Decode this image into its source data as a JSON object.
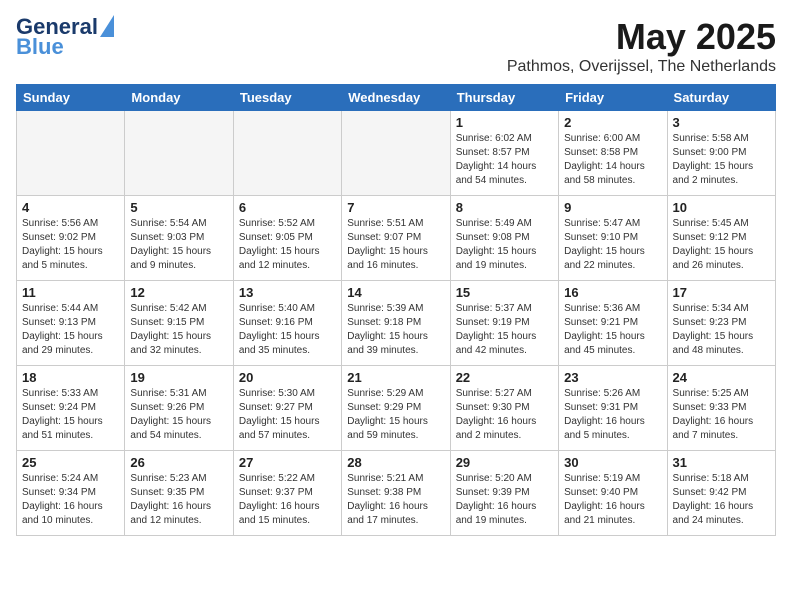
{
  "header": {
    "logo_line1": "General",
    "logo_line2": "Blue",
    "month_title": "May 2025",
    "location": "Pathmos, Overijssel, The Netherlands"
  },
  "days_of_week": [
    "Sunday",
    "Monday",
    "Tuesday",
    "Wednesday",
    "Thursday",
    "Friday",
    "Saturday"
  ],
  "weeks": [
    [
      {
        "day": "",
        "info": ""
      },
      {
        "day": "",
        "info": ""
      },
      {
        "day": "",
        "info": ""
      },
      {
        "day": "",
        "info": ""
      },
      {
        "day": "1",
        "info": "Sunrise: 6:02 AM\nSunset: 8:57 PM\nDaylight: 14 hours\nand 54 minutes."
      },
      {
        "day": "2",
        "info": "Sunrise: 6:00 AM\nSunset: 8:58 PM\nDaylight: 14 hours\nand 58 minutes."
      },
      {
        "day": "3",
        "info": "Sunrise: 5:58 AM\nSunset: 9:00 PM\nDaylight: 15 hours\nand 2 minutes."
      }
    ],
    [
      {
        "day": "4",
        "info": "Sunrise: 5:56 AM\nSunset: 9:02 PM\nDaylight: 15 hours\nand 5 minutes."
      },
      {
        "day": "5",
        "info": "Sunrise: 5:54 AM\nSunset: 9:03 PM\nDaylight: 15 hours\nand 9 minutes."
      },
      {
        "day": "6",
        "info": "Sunrise: 5:52 AM\nSunset: 9:05 PM\nDaylight: 15 hours\nand 12 minutes."
      },
      {
        "day": "7",
        "info": "Sunrise: 5:51 AM\nSunset: 9:07 PM\nDaylight: 15 hours\nand 16 minutes."
      },
      {
        "day": "8",
        "info": "Sunrise: 5:49 AM\nSunset: 9:08 PM\nDaylight: 15 hours\nand 19 minutes."
      },
      {
        "day": "9",
        "info": "Sunrise: 5:47 AM\nSunset: 9:10 PM\nDaylight: 15 hours\nand 22 minutes."
      },
      {
        "day": "10",
        "info": "Sunrise: 5:45 AM\nSunset: 9:12 PM\nDaylight: 15 hours\nand 26 minutes."
      }
    ],
    [
      {
        "day": "11",
        "info": "Sunrise: 5:44 AM\nSunset: 9:13 PM\nDaylight: 15 hours\nand 29 minutes."
      },
      {
        "day": "12",
        "info": "Sunrise: 5:42 AM\nSunset: 9:15 PM\nDaylight: 15 hours\nand 32 minutes."
      },
      {
        "day": "13",
        "info": "Sunrise: 5:40 AM\nSunset: 9:16 PM\nDaylight: 15 hours\nand 35 minutes."
      },
      {
        "day": "14",
        "info": "Sunrise: 5:39 AM\nSunset: 9:18 PM\nDaylight: 15 hours\nand 39 minutes."
      },
      {
        "day": "15",
        "info": "Sunrise: 5:37 AM\nSunset: 9:19 PM\nDaylight: 15 hours\nand 42 minutes."
      },
      {
        "day": "16",
        "info": "Sunrise: 5:36 AM\nSunset: 9:21 PM\nDaylight: 15 hours\nand 45 minutes."
      },
      {
        "day": "17",
        "info": "Sunrise: 5:34 AM\nSunset: 9:23 PM\nDaylight: 15 hours\nand 48 minutes."
      }
    ],
    [
      {
        "day": "18",
        "info": "Sunrise: 5:33 AM\nSunset: 9:24 PM\nDaylight: 15 hours\nand 51 minutes."
      },
      {
        "day": "19",
        "info": "Sunrise: 5:31 AM\nSunset: 9:26 PM\nDaylight: 15 hours\nand 54 minutes."
      },
      {
        "day": "20",
        "info": "Sunrise: 5:30 AM\nSunset: 9:27 PM\nDaylight: 15 hours\nand 57 minutes."
      },
      {
        "day": "21",
        "info": "Sunrise: 5:29 AM\nSunset: 9:29 PM\nDaylight: 15 hours\nand 59 minutes."
      },
      {
        "day": "22",
        "info": "Sunrise: 5:27 AM\nSunset: 9:30 PM\nDaylight: 16 hours\nand 2 minutes."
      },
      {
        "day": "23",
        "info": "Sunrise: 5:26 AM\nSunset: 9:31 PM\nDaylight: 16 hours\nand 5 minutes."
      },
      {
        "day": "24",
        "info": "Sunrise: 5:25 AM\nSunset: 9:33 PM\nDaylight: 16 hours\nand 7 minutes."
      }
    ],
    [
      {
        "day": "25",
        "info": "Sunrise: 5:24 AM\nSunset: 9:34 PM\nDaylight: 16 hours\nand 10 minutes."
      },
      {
        "day": "26",
        "info": "Sunrise: 5:23 AM\nSunset: 9:35 PM\nDaylight: 16 hours\nand 12 minutes."
      },
      {
        "day": "27",
        "info": "Sunrise: 5:22 AM\nSunset: 9:37 PM\nDaylight: 16 hours\nand 15 minutes."
      },
      {
        "day": "28",
        "info": "Sunrise: 5:21 AM\nSunset: 9:38 PM\nDaylight: 16 hours\nand 17 minutes."
      },
      {
        "day": "29",
        "info": "Sunrise: 5:20 AM\nSunset: 9:39 PM\nDaylight: 16 hours\nand 19 minutes."
      },
      {
        "day": "30",
        "info": "Sunrise: 5:19 AM\nSunset: 9:40 PM\nDaylight: 16 hours\nand 21 minutes."
      },
      {
        "day": "31",
        "info": "Sunrise: 5:18 AM\nSunset: 9:42 PM\nDaylight: 16 hours\nand 24 minutes."
      }
    ]
  ]
}
